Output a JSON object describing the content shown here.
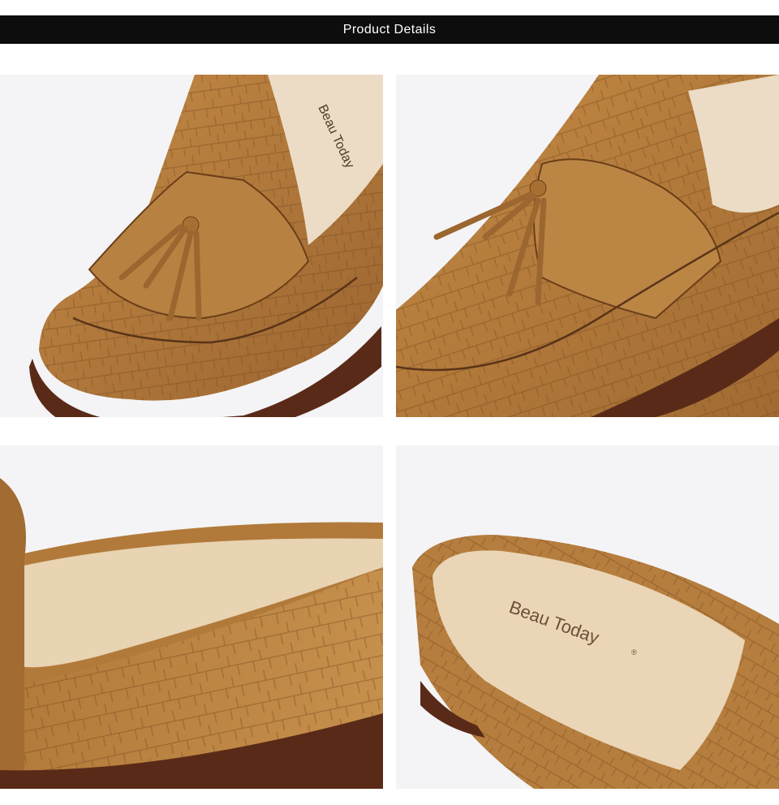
{
  "header": {
    "title": "Product Details",
    "background": "#0d0d0d",
    "text_color": "#ffffff"
  },
  "colors": {
    "leather": "#b07a3a",
    "leather_dark": "#7a4a1e",
    "insole": "#e6cfae",
    "backdrop": "#f4f4f6",
    "sole": "#5a2a18"
  },
  "photos": [
    {
      "subject": "tassel loafer toe, front view"
    },
    {
      "subject": "tassel loafer toe, angled view"
    },
    {
      "subject": "loafer side and insole close-up"
    },
    {
      "subject": "loafer heel and branded insole"
    }
  ],
  "insole_brand": "Beau Today",
  "insole_brand_mark": "®"
}
